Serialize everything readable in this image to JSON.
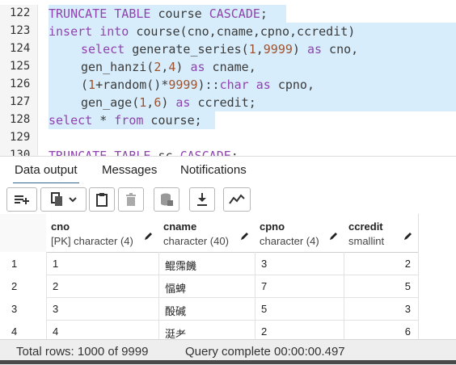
{
  "editor": {
    "lines": [
      {
        "num": "122",
        "highlight": true
      },
      {
        "num": "123",
        "highlight": true
      },
      {
        "num": "124",
        "highlight": true
      },
      {
        "num": "125",
        "highlight": true
      },
      {
        "num": "126",
        "highlight": true
      },
      {
        "num": "127",
        "highlight": true
      },
      {
        "num": "128",
        "highlight": true
      },
      {
        "num": "129",
        "highlight": false
      },
      {
        "num": "130",
        "highlight": false
      }
    ],
    "code": {
      "l122": {
        "a": "TRUNCATE TABLE",
        "b": " course ",
        "c": "CASCADE",
        "d": ";"
      },
      "l123": {
        "a": "insert into",
        "b": " course(cno,cname,cpno,ccredit)"
      },
      "l124": {
        "a": "select",
        "b": " generate_series(",
        "c": "1",
        "d": ",",
        "e": "9999",
        "f": ") ",
        "g": "as",
        "h": " cno,"
      },
      "l125": {
        "a": "gen_hanzi(",
        "b": "2",
        "c": ",",
        "d": "4",
        "e": ") ",
        "f": "as",
        "g": " cname,"
      },
      "l126": {
        "a": "(",
        "b": "1",
        "c": "+random()*",
        "d": "9999",
        "e": ")::",
        "f": "char",
        "g": " ",
        "h": "as",
        "i": " cpno,"
      },
      "l127": {
        "a": "gen_age(",
        "b": "1",
        "c": ",",
        "d": "6",
        "e": ") ",
        "f": "as",
        "g": " ccredit;"
      },
      "l128": {
        "a": "select",
        "b": " * ",
        "c": "from",
        "d": " course;"
      },
      "l130": {
        "a": "TRUNCATE TABLE",
        "b": " sc ",
        "c": "CASCADE",
        "d": ";"
      }
    }
  },
  "tabs": {
    "data_output": "Data output",
    "messages": "Messages",
    "notifications": "Notifications"
  },
  "toolbar": {
    "icons": [
      "add-row-icon",
      "copy-icon",
      "chevron-down-icon",
      "paste-icon",
      "delete-icon",
      "save-data-icon",
      "download-icon",
      "graph-icon"
    ]
  },
  "grid": {
    "columns": [
      {
        "name": "cno",
        "type": "[PK] character (4)"
      },
      {
        "name": "cname",
        "type": "character (40)"
      },
      {
        "name": "cpno",
        "type": "character (4)"
      },
      {
        "name": "ccredit",
        "type": "smallint"
      }
    ],
    "rows": [
      {
        "n": "1",
        "cno": "1",
        "cname": "鲲霈饑",
        "cpno": "3",
        "ccredit": "2"
      },
      {
        "n": "2",
        "cno": "2",
        "cname": "愊蜱",
        "cpno": "7",
        "ccredit": "5"
      },
      {
        "n": "3",
        "cno": "3",
        "cname": "酘碱",
        "cpno": "5",
        "ccredit": "3"
      },
      {
        "n": "4",
        "cno": "4",
        "cname": "涏耂",
        "cpno": "2",
        "ccredit": "6"
      }
    ]
  },
  "status": {
    "total_rows": "Total rows: 1000 of 9999",
    "query": "Query complete 00:00:00.497"
  }
}
